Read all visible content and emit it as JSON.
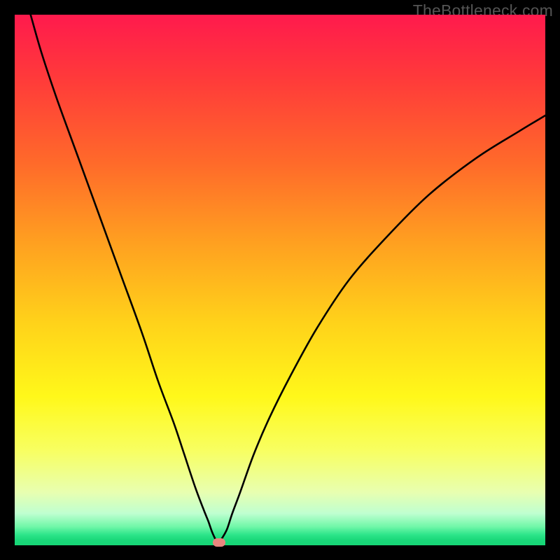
{
  "watermark": "TheBottleneck.com",
  "chart_data": {
    "type": "line",
    "title": "",
    "xlabel": "",
    "ylabel": "",
    "xlim": [
      0,
      100
    ],
    "ylim": [
      0,
      100
    ],
    "grid": false,
    "series": [
      {
        "name": "bottleneck-curve",
        "x": [
          3,
          5,
          8,
          12,
          16,
          20,
          24,
          27,
          30,
          32,
          34,
          35.5,
          36.5,
          37.2,
          37.8,
          38.2,
          38.6,
          39,
          40,
          41,
          42.5,
          45,
          48,
          52,
          57,
          63,
          70,
          78,
          87,
          95,
          100
        ],
        "y": [
          100,
          93,
          84,
          73,
          62,
          51,
          40,
          31,
          23,
          17,
          11,
          7,
          4.5,
          2.5,
          1.2,
          0.5,
          0.5,
          1.2,
          3,
          6,
          10,
          17,
          24,
          32,
          41,
          50,
          58,
          66,
          73,
          78,
          81
        ]
      }
    ],
    "marker": {
      "x": 38.5,
      "y": 0.5,
      "name": "point-marker"
    },
    "background_gradient": {
      "type": "vertical",
      "stops": [
        {
          "pos": 0,
          "color": "#ff1a4d"
        },
        {
          "pos": 0.5,
          "color": "#ffd21a"
        },
        {
          "pos": 0.85,
          "color": "#f8ff60"
        },
        {
          "pos": 1.0,
          "color": "#16d575"
        }
      ]
    }
  }
}
